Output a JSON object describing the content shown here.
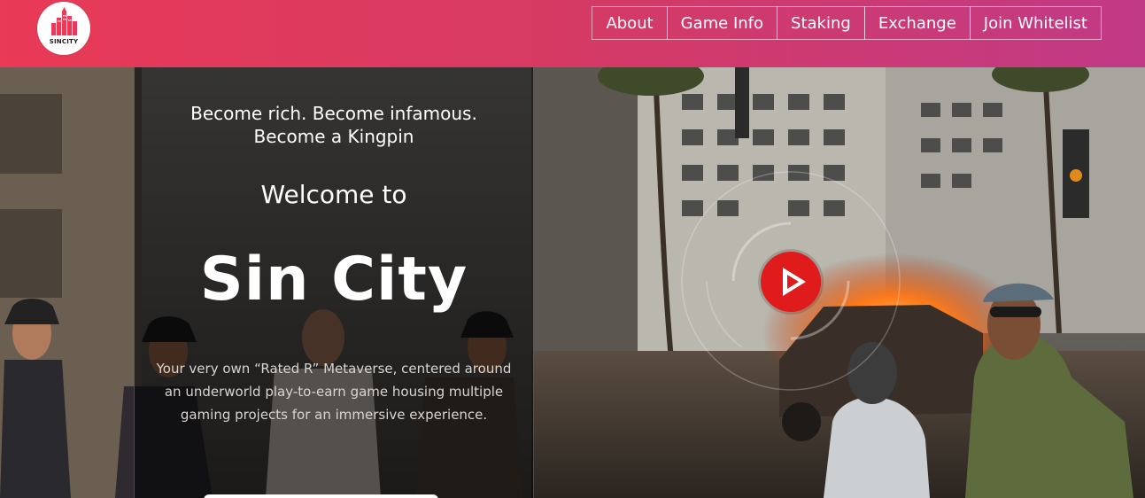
{
  "brand": {
    "logo_text": "SINCITY"
  },
  "nav": {
    "items": [
      {
        "label": "About"
      },
      {
        "label": "Game Info"
      },
      {
        "label": "Staking"
      },
      {
        "label": "Exchange"
      },
      {
        "label": "Join Whitelist"
      }
    ]
  },
  "hero": {
    "tagline_line1": "Become rich. Become infamous.",
    "tagline_line2": "Become a Kingpin",
    "welcome": "Welcome to",
    "title": "Sin City",
    "description": "Your very own “Rated R” Metaverse, centered around an underworld play-to-earn game housing multiple gaming projects for an immersive experience."
  },
  "colors": {
    "header_start": "#e93a57",
    "header_end": "#c13a86",
    "play_button": "#e01b1b"
  }
}
